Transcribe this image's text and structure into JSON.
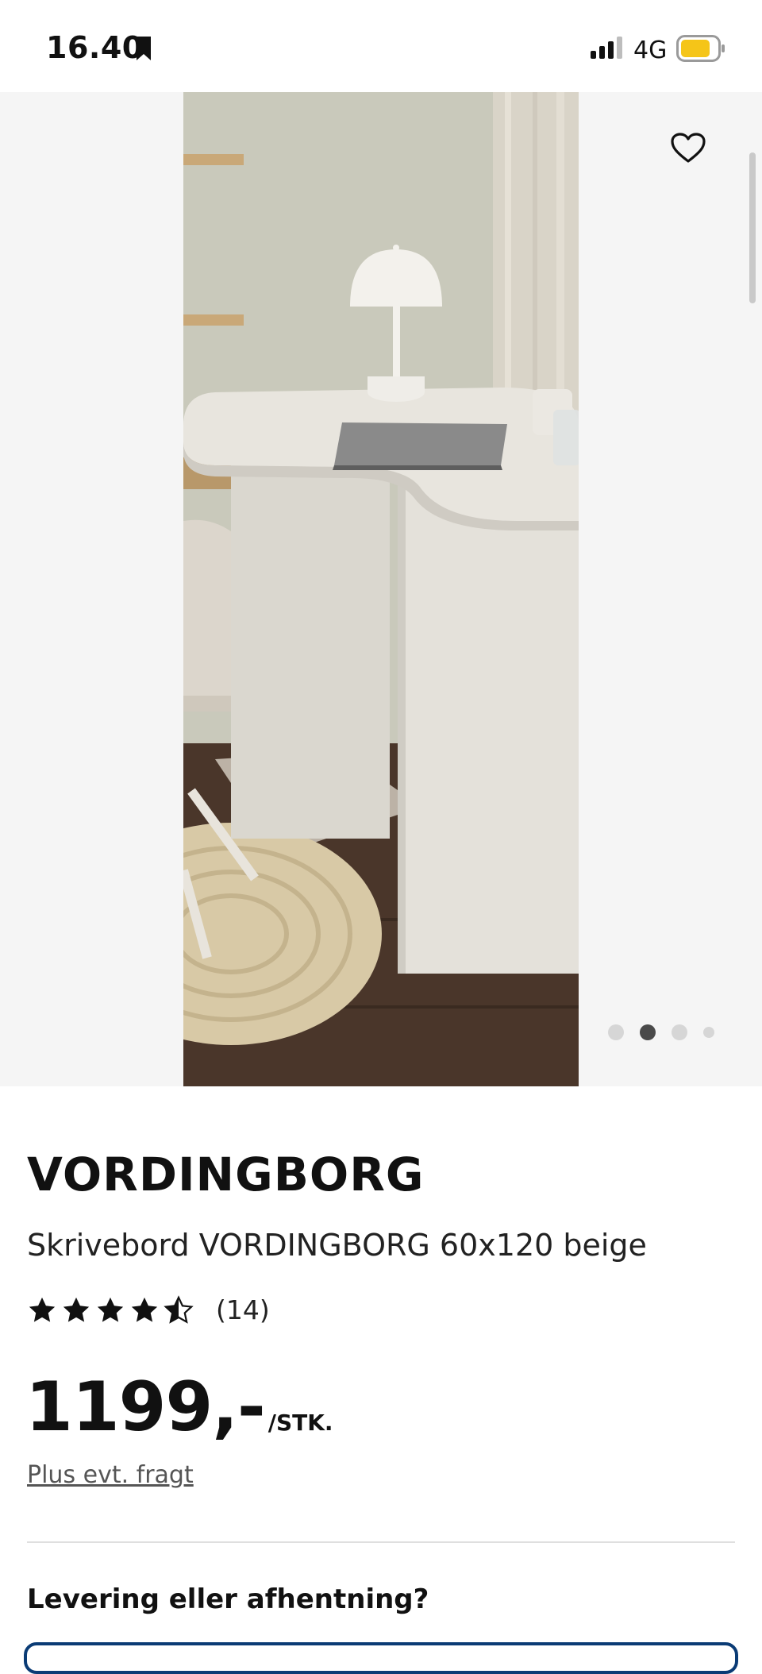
{
  "status_bar": {
    "time": "16.40",
    "network": "4G",
    "icons": [
      "bookmark-icon",
      "signal-icon",
      "battery-icon"
    ],
    "battery_color": "#f5c518"
  },
  "gallery": {
    "image": "desk-photo",
    "wishlist_icon": "heart-icon",
    "dots_count": 4,
    "active_dot": 2
  },
  "product": {
    "name": "VORDINGBORG",
    "description": "Skrivebord VORDINGBORG 60x120 beige",
    "rating_value": 4.5,
    "rating_max": 5,
    "review_count": "(14)",
    "price": "1199,-",
    "price_unit": "/STK.",
    "shipping_note": "Plus evt. fragt"
  },
  "delivery": {
    "heading": "Levering eller afhentning?",
    "accent_color": "#0a3b75"
  }
}
